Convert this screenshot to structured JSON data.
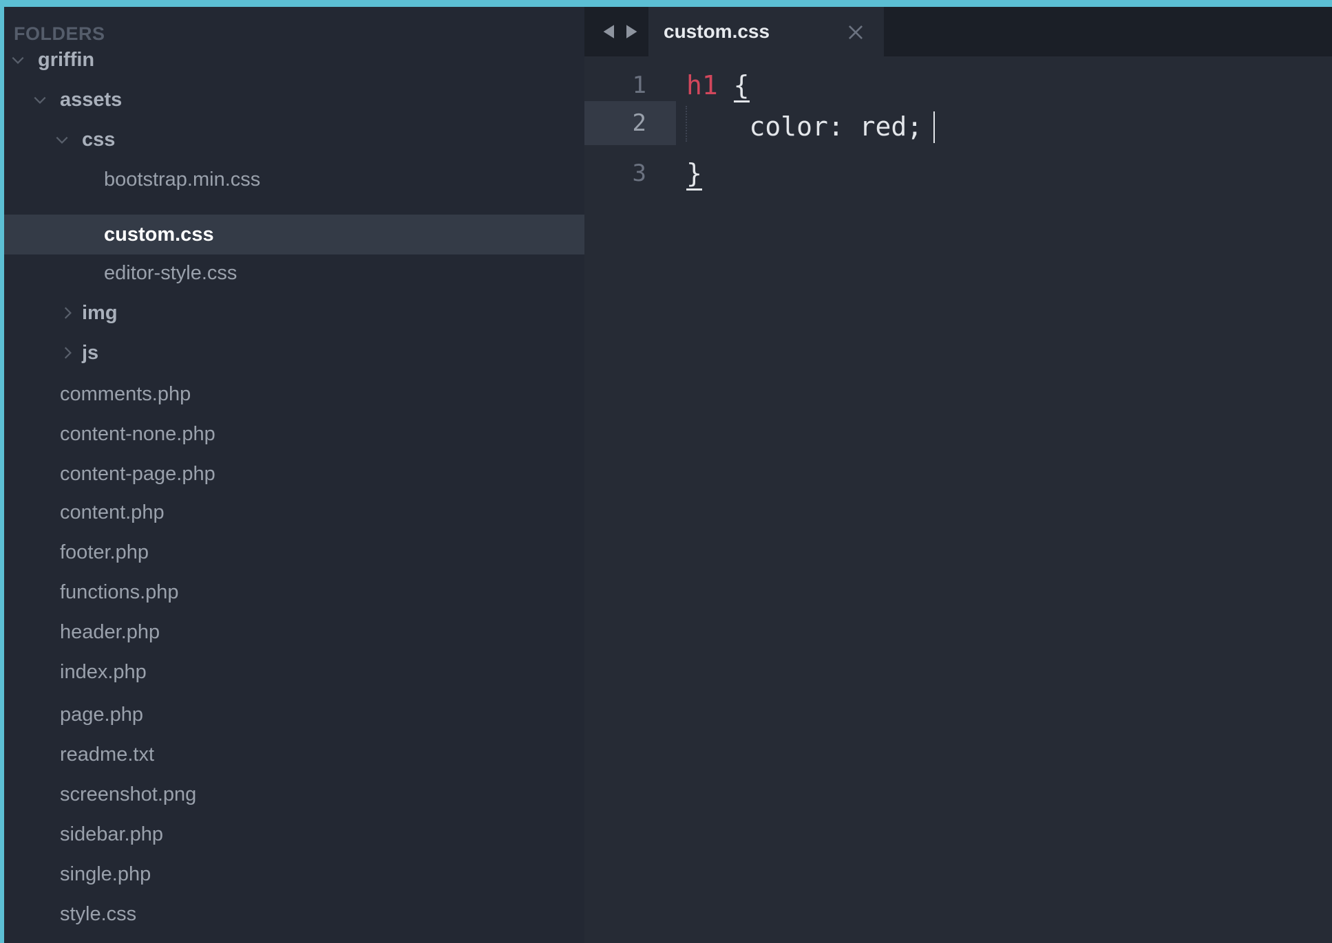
{
  "sidebar": {
    "header": "FOLDERS",
    "items": [
      {
        "label": "griffin",
        "type": "folder",
        "expanded": true
      },
      {
        "label": "assets",
        "type": "folder",
        "expanded": true
      },
      {
        "label": "css",
        "type": "folder",
        "expanded": true
      },
      {
        "label": "bootstrap.min.css",
        "type": "file"
      },
      {
        "label": "custom.css",
        "type": "file",
        "selected": true
      },
      {
        "label": "editor-style.css",
        "type": "file"
      },
      {
        "label": "img",
        "type": "folder",
        "expanded": false
      },
      {
        "label": "js",
        "type": "folder",
        "expanded": false
      },
      {
        "label": "comments.php",
        "type": "file"
      },
      {
        "label": "content-none.php",
        "type": "file"
      },
      {
        "label": "content-page.php",
        "type": "file"
      },
      {
        "label": "content.php",
        "type": "file"
      },
      {
        "label": "footer.php",
        "type": "file"
      },
      {
        "label": "functions.php",
        "type": "file"
      },
      {
        "label": "header.php",
        "type": "file"
      },
      {
        "label": "index.php",
        "type": "file"
      },
      {
        "label": "page.php",
        "type": "file"
      },
      {
        "label": "readme.txt",
        "type": "file"
      },
      {
        "label": "screenshot.png",
        "type": "file"
      },
      {
        "label": "sidebar.php",
        "type": "file"
      },
      {
        "label": "single.php",
        "type": "file"
      },
      {
        "label": "style.css",
        "type": "file"
      }
    ]
  },
  "tabs": {
    "active": {
      "label": "custom.css"
    },
    "icons": {
      "back": "left-arrow-icon",
      "forward": "right-arrow-icon",
      "close": "close-icon"
    }
  },
  "editor": {
    "lines": [
      {
        "number": "1",
        "selector": "h1",
        "text": " ",
        "brace": "{"
      },
      {
        "number": "2",
        "text": "    color: red;"
      },
      {
        "number": "3",
        "brace": "}"
      }
    ],
    "active_line": "2"
  },
  "colors": {
    "background": "#262b35",
    "sidebar": "#232833",
    "selection": "#343b47",
    "selector": "#d2475c",
    "frame": "#5cbfd4"
  }
}
